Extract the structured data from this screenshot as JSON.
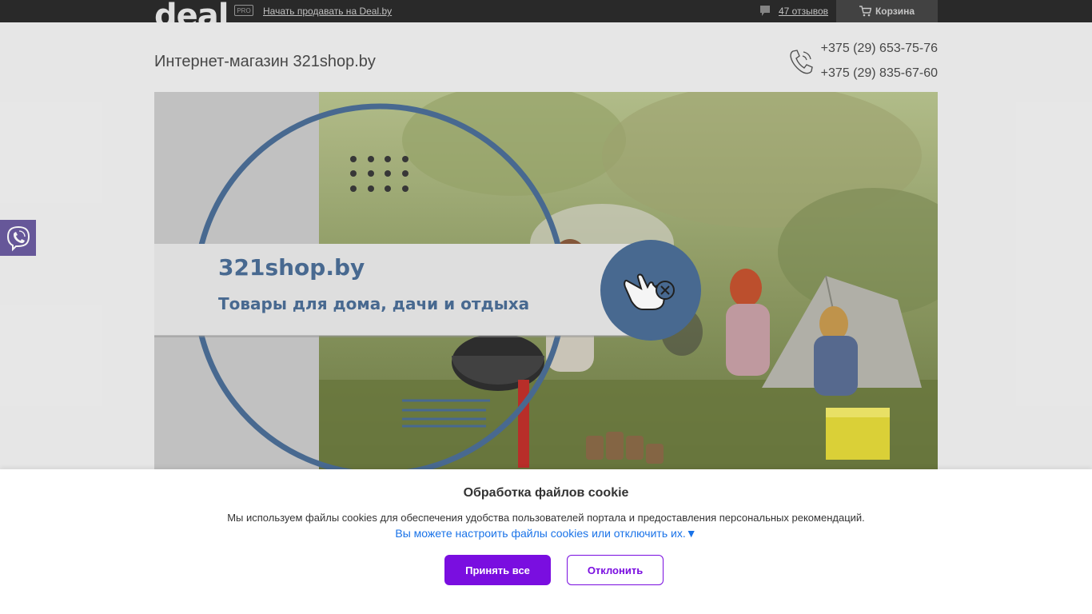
{
  "topbar": {
    "logo": "deal",
    "pro_badge": "PRO",
    "sell_link": "Начать продавать на Deal.by",
    "reviews": "47 отзывов",
    "cart": "Корзина"
  },
  "header": {
    "shop_title": "Интернет-магазин 321shop.by",
    "phones": [
      "+375 (29) 653-75-76",
      "+375 (29) 835-67-60"
    ]
  },
  "banner": {
    "brand": "321shop.by",
    "tagline": "Товары для дома, дачи и отдыха"
  },
  "cookie": {
    "title": "Обработка файлов cookie",
    "text": "Мы используем файлы cookies для обеспечения удобства пользователей портала и предоставления персональных рекомендаций.",
    "settings_link": "Вы можете настроить файлы cookies или отключить их.▼",
    "accept_label": "Принять все",
    "decline_label": "Отклонить"
  },
  "colors": {
    "accent": "#7a0ee0",
    "link": "#1a73e8",
    "topbar": "#2b2b2b",
    "viber": "#6b5ba0",
    "banner_blue": "#4b6e96"
  },
  "icons": [
    "comment-icon",
    "cart-icon",
    "phone-icon",
    "viber-icon",
    "hand-cursor-icon"
  ]
}
